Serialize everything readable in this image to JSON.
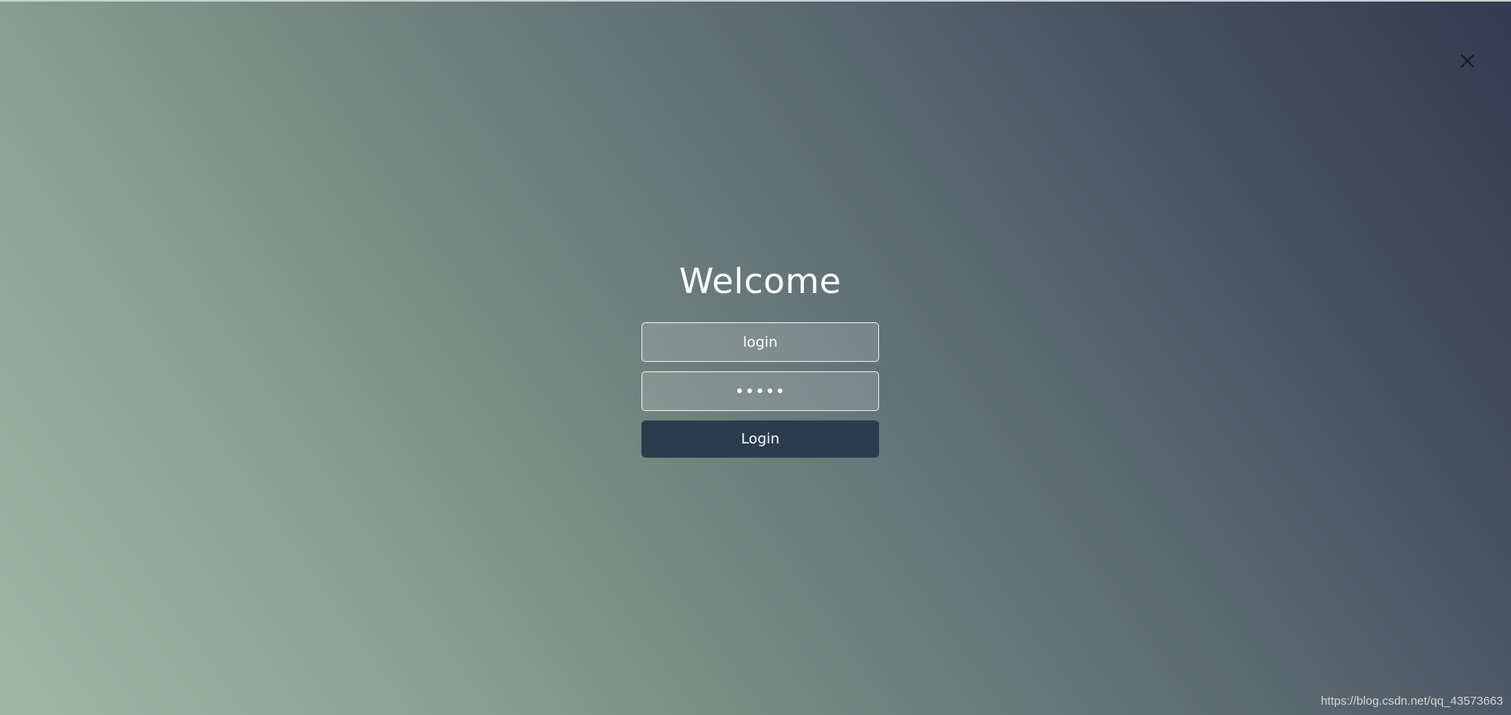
{
  "page": {
    "accent": "#2c3c4f",
    "gradient_colors": [
      "#9fb8a6",
      "#8aa292",
      "#6f817d",
      "#5a6870",
      "#45505f",
      "#343a50"
    ]
  },
  "window": {
    "close_icon": "close-icon"
  },
  "login": {
    "title": "Welcome",
    "username_value": "login",
    "password_value": "12345",
    "submit_label": "Login"
  },
  "watermark": {
    "text": "https://blog.csdn.net/qq_43573663"
  }
}
